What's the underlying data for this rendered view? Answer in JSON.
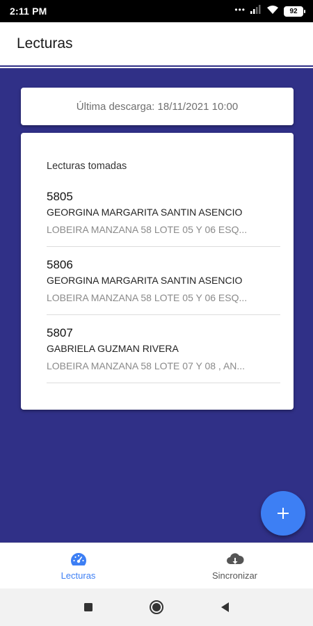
{
  "status_bar": {
    "time": "2:11 PM",
    "battery": "92",
    "signal_icon": "signal-icon",
    "wifi_icon": "wifi-icon"
  },
  "app_bar": {
    "title": "Lecturas"
  },
  "download": {
    "text": "Última descarga: 18/11/2021 10:00"
  },
  "readings": {
    "title": "Lecturas tomadas",
    "items": [
      {
        "number": "5805",
        "name": "GEORGINA MARGARITA SANTIN ASENCIO",
        "address": "LOBEIRA MANZANA 58 LOTE 05 Y 06 ESQ..."
      },
      {
        "number": "5806",
        "name": "GEORGINA MARGARITA SANTIN ASENCIO",
        "address": "LOBEIRA MANZANA 58 LOTE 05 Y 06 ESQ..."
      },
      {
        "number": "5807",
        "name": "GABRIELA GUZMAN RIVERA",
        "address": "LOBEIRA MANZANA 58 LOTE 07 Y 08 , AN..."
      }
    ]
  },
  "fab": {
    "icon": "plus-icon"
  },
  "bottom_nav": {
    "items": [
      {
        "label": "Lecturas",
        "icon": "speedometer-icon",
        "active": true
      },
      {
        "label": "Sincronizar",
        "icon": "cloud-download-icon",
        "active": false
      }
    ]
  },
  "system_nav": {
    "icons": [
      "recents-icon",
      "home-icon",
      "back-icon"
    ]
  },
  "colors": {
    "primary": "#303087",
    "accent": "#3d7ff4",
    "status_bar": "#000000",
    "card": "#ffffff"
  }
}
